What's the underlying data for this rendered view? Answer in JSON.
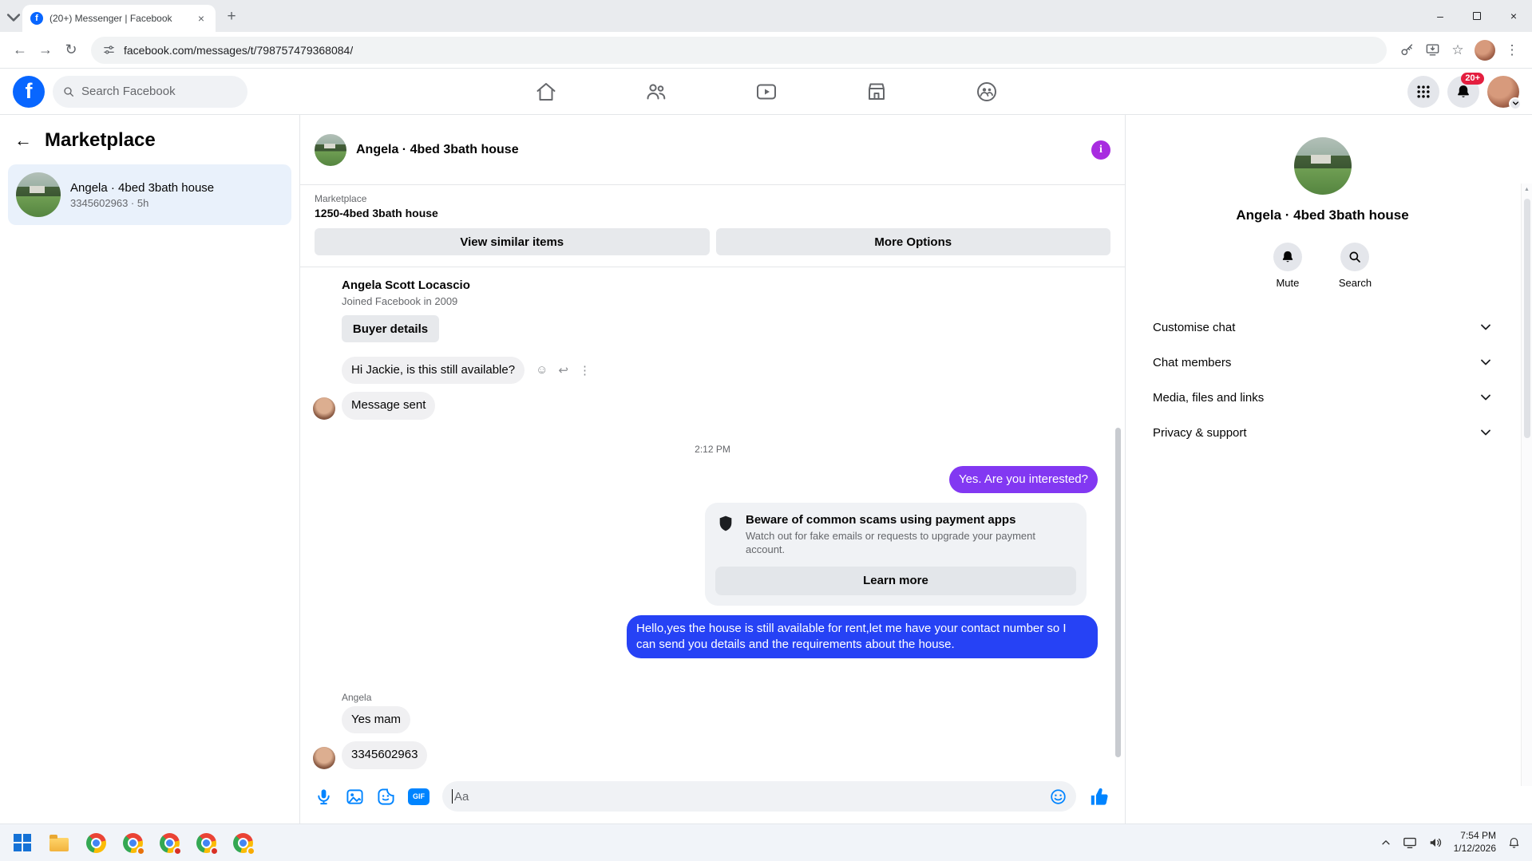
{
  "colors": {
    "fb_blue": "#0866ff",
    "messenger_icon_blue": "#0084ff",
    "bubble_purple": "#8238f2",
    "bubble_blue": "#2642f5",
    "received_bubble_gray": "#f0f0f2",
    "notification_badge_red": "#e41e3f",
    "info_icon_purple": "#a82ce0"
  },
  "icons": {
    "back": "←",
    "forward": "→",
    "refresh": "↻",
    "star": "☆",
    "menu_dots": "⋮",
    "close": "×",
    "new_tab": "+",
    "minimize": "–",
    "smiley": "☺",
    "reply": "↩",
    "more_dots": "⋮",
    "scroll_up_arrow": "▲",
    "logo_letter": "f",
    "info_letter": "i"
  },
  "browser": {
    "tab_title": "(20+) Messenger | Facebook",
    "url": "facebook.com/messages/t/798757479368084/"
  },
  "fb_header": {
    "search_placeholder": "Search Facebook",
    "notification_count": "20+"
  },
  "sidebar": {
    "title": "Marketplace",
    "conversation": {
      "name": "Angela · 4bed 3bath house",
      "meta": "3345602963 · 5h"
    }
  },
  "chat": {
    "title": "Angela · 4bed 3bath house",
    "marketplace_label": "Marketplace",
    "listing_title": "1250-4bed 3bath house",
    "view_similar_label": "View similar items",
    "more_options_label": "More Options",
    "buyer": {
      "name": "Angela Scott Locascio",
      "joined": "Joined Facebook in 2009",
      "buyer_details_label": "Buyer details"
    },
    "messages": {
      "incoming_1": "Hi Jackie, is this still available?",
      "incoming_2": "Message sent",
      "time_divider": "2:12 PM",
      "outgoing_1": "Yes. Are you interested?",
      "outgoing_2": "Hello,yes the house is still available for rent,let me have your contact number   so I can send you details and the requirements about the house.",
      "sender_label": "Angela",
      "incoming_3": "Yes mam",
      "incoming_4": "3345602963"
    },
    "scam_notice": {
      "title": "Beware of common scams using payment apps",
      "body": "Watch out for fake emails or requests to upgrade your payment account.",
      "learn_more_label": "Learn more"
    },
    "composer": {
      "placeholder": "Aa",
      "gif_label": "GIF"
    }
  },
  "right_panel": {
    "title": "Angela · 4bed 3bath house",
    "mute_label": "Mute",
    "search_label": "Search",
    "menu": [
      "Customise chat",
      "Chat members",
      "Media, files and links",
      "Privacy & support"
    ]
  },
  "taskbar": {
    "time": "7:54 PM",
    "date": "1/12/2026"
  }
}
